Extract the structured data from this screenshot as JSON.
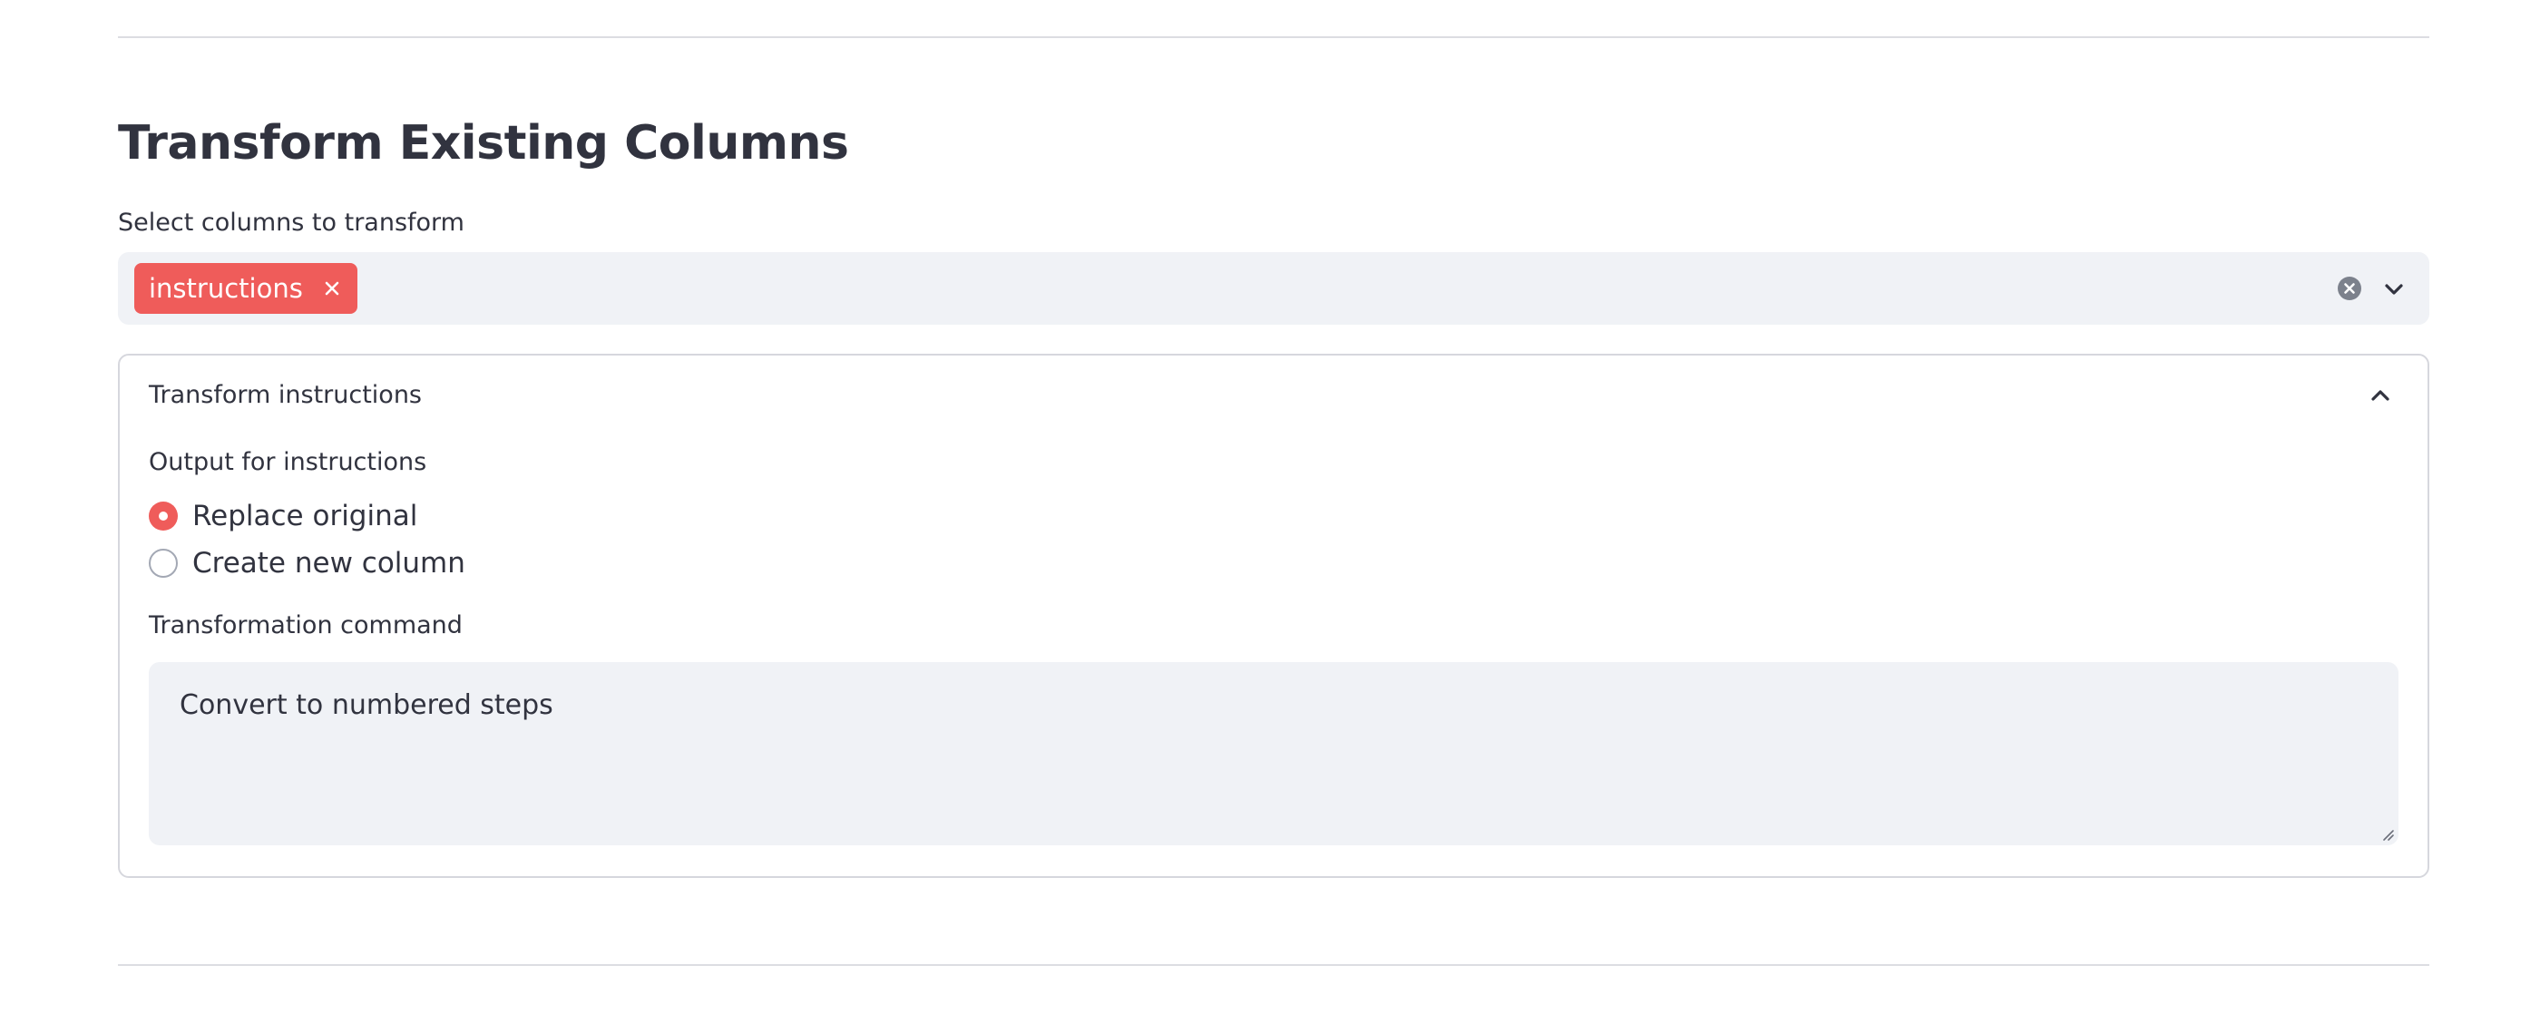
{
  "section": {
    "title": "Transform Existing Columns"
  },
  "column_select": {
    "label": "Select columns to transform",
    "selected": [
      {
        "label": "instructions"
      }
    ]
  },
  "expander": {
    "title": "Transform instructions",
    "expanded": true,
    "output": {
      "label": "Output for instructions",
      "options": [
        {
          "label": "Replace original",
          "selected": true
        },
        {
          "label": "Create new column",
          "selected": false
        }
      ]
    },
    "command": {
      "label": "Transformation command",
      "value": "Convert to numbered steps"
    }
  },
  "icons": {
    "chip_remove": "close-icon",
    "clear": "clear-circle-icon",
    "dropdown": "chevron-down-icon",
    "collapse": "chevron-up-icon",
    "resize": "resize-grip-icon"
  },
  "colors": {
    "accent": "#ef5c5a",
    "input_background": "#f0f2f6",
    "text": "#31333f",
    "border": "#d6d7dd"
  }
}
